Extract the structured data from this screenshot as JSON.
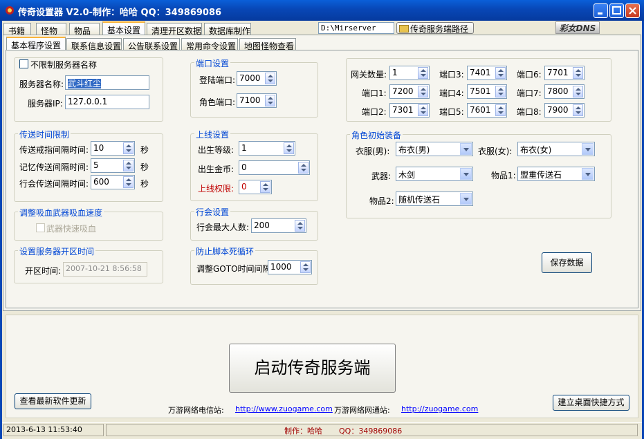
{
  "window": {
    "title": "传奇设置器  V2.0-制作：哈哈  QQ：349869086"
  },
  "top_tabs": [
    "书籍",
    "怪物",
    "物品",
    "基本设置",
    "清理开区数据",
    "数据库制作"
  ],
  "server_path": {
    "value": "D:\\Mirserver",
    "button_label": "传奇服务端路径"
  },
  "logo_text": "彩女DNS",
  "sub_tabs": [
    "基本程序设置",
    "联系信息设置",
    "公告联系设置",
    "常用命令设置",
    "地图怪物查看"
  ],
  "server_group": {
    "unlimited_name_label": "不限制服务器名称",
    "name_label": "服务器名称:",
    "name_value": "武斗红尘",
    "ip_label": "服务器IP:",
    "ip_value": "127.0.0.1"
  },
  "teleport_group": {
    "title": "传送时间限制",
    "ring_label": "传送戒指间隔时间:",
    "ring_value": "10",
    "memory_label": "记忆传送间隔时间:",
    "memory_value": "5",
    "guild_label": "行会传送间隔时间:",
    "guild_value": "600",
    "unit": "秒"
  },
  "vampire_group": {
    "title": "调整吸血武器吸血速度",
    "fast_label": "武器快速吸血"
  },
  "open_time_group": {
    "title": "设置服务器开区时间",
    "label": "开区时间:",
    "value": "2007-10-21  8:56:58"
  },
  "port_group": {
    "title": "端口设置",
    "login_label": "登陆端口:",
    "login_value": "7000",
    "char_label": "角色端口:",
    "char_value": "7100"
  },
  "online_group": {
    "title": "上线设置",
    "level_label": "出生等级:",
    "level_value": "1",
    "gold_label": "出生金币:",
    "gold_value": "0",
    "perm_label": "上线权限:",
    "perm_value": "0"
  },
  "guild_group": {
    "title": "行会设置",
    "max_label": "行会最大人数:",
    "max_value": "200"
  },
  "loop_group": {
    "title": "防止脚本死循环",
    "goto_label": "调整GOTO时间间隔:",
    "goto_value": "1000"
  },
  "gateway_group": {
    "count_label": "网关数量:",
    "count_value": "1",
    "ports": [
      {
        "label": "端口1:",
        "value": "7200"
      },
      {
        "label": "端口2:",
        "value": "7301"
      },
      {
        "label": "端口3:",
        "value": "7401"
      },
      {
        "label": "端口4:",
        "value": "7501"
      },
      {
        "label": "端口5:",
        "value": "7601"
      },
      {
        "label": "端口6:",
        "value": "7701"
      },
      {
        "label": "端口7:",
        "value": "7800"
      },
      {
        "label": "端口8:",
        "value": "7900"
      }
    ]
  },
  "equip_group": {
    "title": "角色初始装备",
    "male_cloth_label": "衣服(男):",
    "male_cloth_value": "布衣(男)",
    "female_cloth_label": "衣服(女):",
    "female_cloth_value": "布衣(女)",
    "weapon_label": "武器:",
    "weapon_value": "木剑",
    "item1_label": "物品1:",
    "item1_value": "盟重传送石",
    "item2_label": "物品2:",
    "item2_value": "随机传送石"
  },
  "save_button": "保存数据",
  "start_button": "启动传奇服务端",
  "update_button": "查看最新软件更新",
  "shortcut_button": "建立桌面快捷方式",
  "links": {
    "telecom_label": "万游网络电信站:",
    "telecom_url": "http://www.zuogame.com",
    "netcom_label": "万游网络网通站:",
    "netcom_url": "http://zuogame.com"
  },
  "status_bar": {
    "datetime": "2013-6-13  11:53:40",
    "author": "制作：哈哈",
    "qq": "QQ：349869086"
  }
}
